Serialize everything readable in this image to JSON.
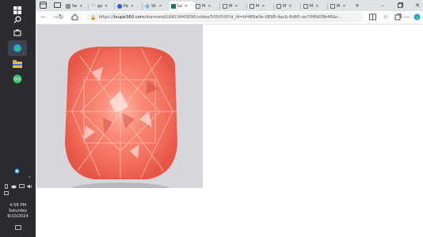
{
  "taskbar": {
    "clock_time": "4:58 PM",
    "clock_day": "Saturday",
    "clock_date": "8/10/2024"
  },
  "tabs": [
    {
      "label": "Se",
      "favicon": "page-icon"
    },
    {
      "label": "ga",
      "favicon": "google-icon"
    },
    {
      "label": "Pa",
      "favicon": "heart-icon"
    },
    {
      "label": "Sh",
      "favicon": "diamond-icon"
    },
    {
      "label": "Lo",
      "favicon": "loupe-icon"
    },
    {
      "label": "M",
      "favicon": "page-icon"
    },
    {
      "label": "M",
      "favicon": "page-icon"
    },
    {
      "label": "M",
      "favicon": "page-icon"
    },
    {
      "label": "M",
      "favicon": "page-icon"
    },
    {
      "label": "M",
      "favicon": "page-icon"
    },
    {
      "label": "M",
      "favicon": "page-icon"
    }
  ],
  "address_bar": {
    "protocol": "https://",
    "host": "loupe360.com",
    "path": "/diamond/LG619443095/video/500/500?d_id=bf489a0e-0898-4acb-8d80-ae70f6b09b48&c..."
  },
  "colors": {
    "taskbar_bg": "#2a2a2f",
    "tabstrip_bg": "#dfe3e8",
    "video_bg": "#d7d7db",
    "diamond_main": "#f36e5c"
  }
}
